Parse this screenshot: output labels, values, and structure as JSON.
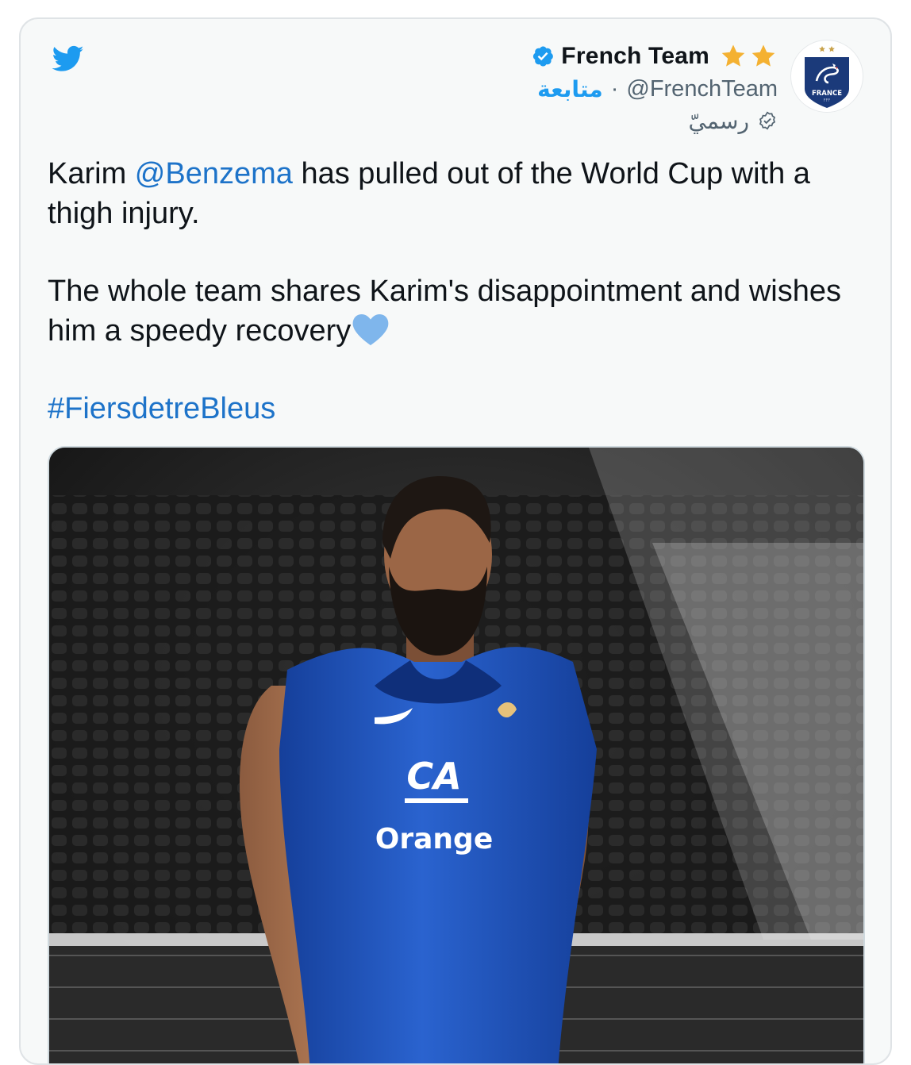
{
  "tweet": {
    "display_name": "French Team",
    "handle": "@FrenchTeam",
    "follow_label": "متابعة",
    "separator": "·",
    "account_label": "رسميّ",
    "avatar_text": "FRANCE",
    "avatar_subtext": "FFF",
    "body": {
      "p1_before": "Karim ",
      "p1_mention": "@Benzema",
      "p1_after": " has pulled out of the World Cup with a thigh injury.",
      "p2": "The whole team shares Karim's disappointment and wishes him a speedy recovery",
      "hashtag": "#FiersdetreBleus"
    },
    "media": {
      "jersey_sponsor_logo": "CA",
      "jersey_sponsor_text": "Orange"
    }
  },
  "icons": {
    "brand": "twitter-bird-icon",
    "verified": "verified-badge-icon",
    "stars": "gold-star-icon",
    "official": "official-label-icon",
    "emoji": "blue-heart-icon"
  },
  "colors": {
    "twitter_blue": "#1d9bf0",
    "link_blue": "#1d73c9",
    "star_gold": "#f4b132",
    "heart_blue": "#7fb6ec",
    "jersey_blue": "#1f57c2"
  }
}
